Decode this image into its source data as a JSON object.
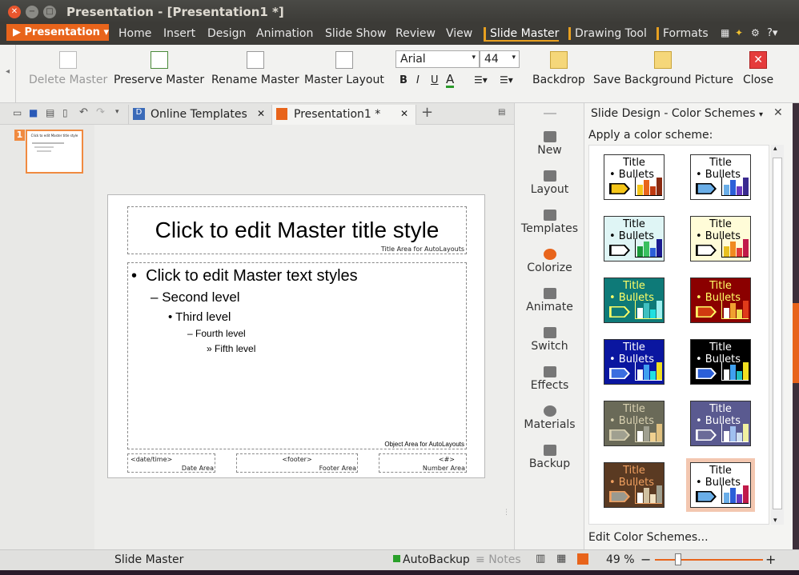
{
  "window": {
    "title": "Presentation - [Presentation1 *]"
  },
  "menubar": {
    "app_button": "Presentation",
    "items": [
      "Home",
      "Insert",
      "Design",
      "Animation",
      "Slide Show",
      "Review",
      "View"
    ],
    "context_tabs": [
      "Slide Master",
      "Drawing Tool",
      "Formats"
    ],
    "active": "Slide Master"
  },
  "ribbon": {
    "delete_master": "Delete Master",
    "preserve_master": "Preserve Master",
    "rename_master": "Rename Master",
    "master_layout": "Master Layout",
    "font_name": "Arial",
    "font_size": "44",
    "bold": "B",
    "italic": "I",
    "underline": "U",
    "font_color": "A",
    "backdrop": "Backdrop",
    "save_background": "Save Background Picture",
    "close": "Close"
  },
  "doc_tabs": {
    "online_templates": "Online Templates",
    "presentation": "Presentation1 *"
  },
  "thumbnail": {
    "number": "1",
    "title": "Click to edit Master title style"
  },
  "slide": {
    "title": "Click to edit Master title style",
    "title_area": "Title Area for AutoLayouts",
    "bullets": [
      {
        "marker": "•",
        "text": "Click to edit Master text styles"
      },
      {
        "marker": "–",
        "text": "Second level"
      },
      {
        "marker": "•",
        "text": "Third level"
      },
      {
        "marker": "–",
        "text": "Fourth level"
      },
      {
        "marker": "»",
        "text": "Fifth level"
      }
    ],
    "object_area": "Object Area for AutoLayouts",
    "date_placeholder": "<date/time>",
    "date_area": "Date Area",
    "footer_placeholder": "<footer>",
    "footer_area": "Footer Area",
    "number_placeholder": "<#>",
    "number_area": "Number Area"
  },
  "task_buttons": [
    "New",
    "Layout",
    "Templates",
    "Colorize",
    "Animate",
    "Switch",
    "Effects",
    "Materials",
    "Backup"
  ],
  "pane": {
    "title": "Slide Design - Color Schemes",
    "subtitle": "Apply a color scheme:",
    "edit": "Edit Color Schemes...",
    "swatch_title": "Title",
    "swatch_bullets": "Bullets",
    "schemes": [
      {
        "bg": "#ffffff",
        "fg": "#000000",
        "accent": "#f5c518"
      },
      {
        "bg": "#ffffff",
        "fg": "#000000",
        "accent": "#6aaee8"
      },
      {
        "bg": "#dff5f5",
        "fg": "#000000",
        "accent": "#ffffff"
      },
      {
        "bg": "#fffcd8",
        "fg": "#000000",
        "accent": "#ffffff"
      },
      {
        "bg": "#0e7a78",
        "fg": "#ffff66",
        "accent": "#0e7a78"
      },
      {
        "bg": "#8b0000",
        "fg": "#ffff66",
        "accent": "#d03a10"
      },
      {
        "bg": "#0a16a0",
        "fg": "#ffffff",
        "accent": "#3b6ee0"
      },
      {
        "bg": "#000000",
        "fg": "#ffffff",
        "accent": "#2b5fd8"
      },
      {
        "bg": "#6a6a58",
        "fg": "#d8d0b0",
        "accent": "#a0a090"
      },
      {
        "bg": "#5a5a90",
        "fg": "#ffffff",
        "accent": "#6a6a98"
      },
      {
        "bg": "#5a3a22",
        "fg": "#f0a060",
        "accent": "#9a9a90"
      },
      {
        "bg": "#ffffff",
        "fg": "#000000",
        "accent": "#6aaee8"
      }
    ]
  },
  "status": {
    "mode": "Slide Master",
    "autobackup": "AutoBackup",
    "notes": "Notes",
    "zoom": "49 %",
    "zoom_minus": "−",
    "zoom_plus": "+"
  }
}
